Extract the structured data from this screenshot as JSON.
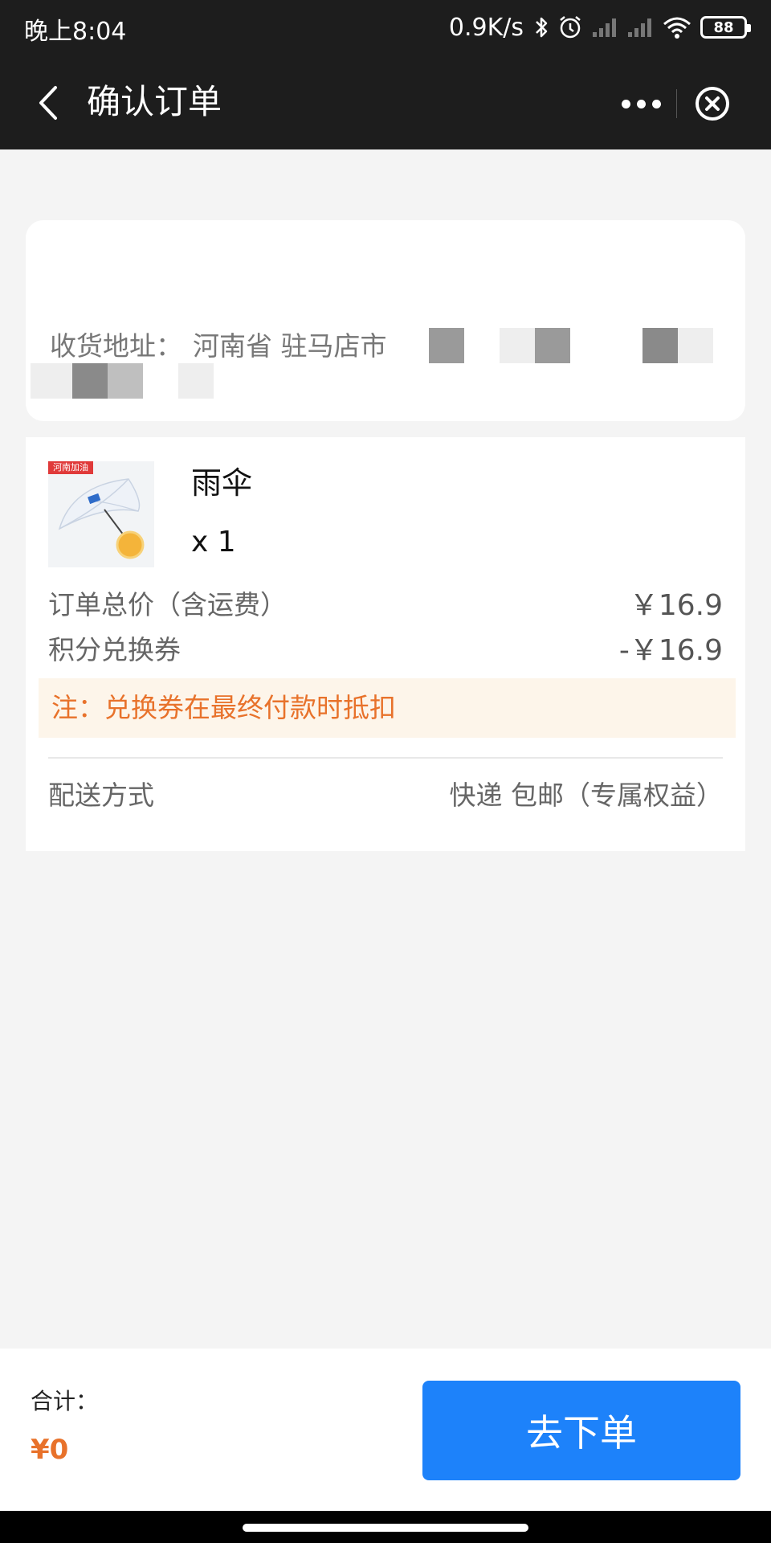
{
  "status_bar": {
    "time": "晚上8:04",
    "net_speed": "0.9K/s",
    "battery": "88"
  },
  "nav": {
    "title": "确认订单"
  },
  "address": {
    "label": "收货地址：",
    "text": "河南省 驻马店市"
  },
  "product": {
    "thumb_tag": "河南加油",
    "name": "雨伞",
    "quantity": "x 1"
  },
  "summary": {
    "total_label": "订单总价（含运费）",
    "total_value": "￥16.9",
    "coupon_label": "积分兑换券",
    "coupon_value": "-￥16.9",
    "notice": "注：兑换券在最终付款时抵扣",
    "delivery_label": "配送方式",
    "delivery_value": "快递 包邮（专属权益）"
  },
  "bottom": {
    "total_label": "合计：",
    "total_amount": "¥0",
    "order_button": "去下单"
  },
  "colors": {
    "accent": "#1d82fa",
    "price_orange": "#e8722b",
    "notice_bg": "#fdf5ea",
    "nav_bg": "#1d1d1d"
  }
}
